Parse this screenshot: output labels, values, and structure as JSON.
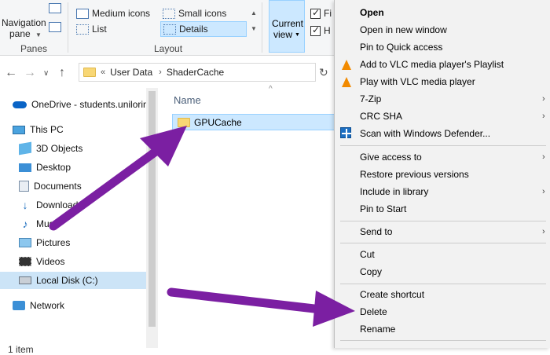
{
  "ribbon": {
    "nav_pane_label": "Navigation",
    "nav_pane_label2": "pane",
    "panes_group": "Panes",
    "layout_group": "Layout",
    "medium_icons": "Medium icons",
    "small_icons": "Small icons",
    "list": "List",
    "details": "Details",
    "current_view": "Current",
    "current_view2": "view",
    "check1": "Fi",
    "check2": "H"
  },
  "address": {
    "prefix": "«",
    "segments": [
      "User Data",
      "ShaderCache"
    ]
  },
  "navpane": {
    "items": [
      {
        "label": "OneDrive - students.unilorin",
        "icon": "onedrive-icon"
      },
      {
        "label": "This PC",
        "icon": "computer-icon"
      },
      {
        "label": "3D Objects",
        "icon": "3d-objects-icon"
      },
      {
        "label": "Desktop",
        "icon": "desktop-icon"
      },
      {
        "label": "Documents",
        "icon": "documents-icon"
      },
      {
        "label": "Downloads",
        "icon": "downloads-icon"
      },
      {
        "label": "Music",
        "icon": "music-icon"
      },
      {
        "label": "Pictures",
        "icon": "pictures-icon"
      },
      {
        "label": "Videos",
        "icon": "videos-icon"
      },
      {
        "label": "Local Disk (C:)",
        "icon": "drive-icon"
      },
      {
        "label": "Network",
        "icon": "network-icon"
      }
    ]
  },
  "content": {
    "column_name": "Name",
    "file": "GPUCache"
  },
  "status": "1 item",
  "context_menu": {
    "items": [
      {
        "label": "Open",
        "bold": true
      },
      {
        "label": "Open in new window"
      },
      {
        "label": "Pin to Quick access"
      },
      {
        "label": "Add to VLC media player's Playlist",
        "icon": "vlc-icon"
      },
      {
        "label": "Play with VLC media player",
        "icon": "vlc-icon"
      },
      {
        "label": "7-Zip",
        "submenu": true
      },
      {
        "label": "CRC SHA",
        "submenu": true
      },
      {
        "label": "Scan with Windows Defender...",
        "icon": "defender-icon"
      },
      {
        "label": "Give access to",
        "submenu": true
      },
      {
        "label": "Restore previous versions"
      },
      {
        "label": "Include in library",
        "submenu": true
      },
      {
        "label": "Pin to Start"
      },
      {
        "label": "Send to",
        "submenu": true
      },
      {
        "label": "Cut"
      },
      {
        "label": "Copy"
      },
      {
        "label": "Create shortcut"
      },
      {
        "label": "Delete"
      },
      {
        "label": "Rename"
      }
    ]
  },
  "colors": {
    "selection": "#cce8ff",
    "arrow": "#7b1fa2",
    "menu_bg": "#f2f2f2",
    "vlc_orange": "#f28a00"
  }
}
